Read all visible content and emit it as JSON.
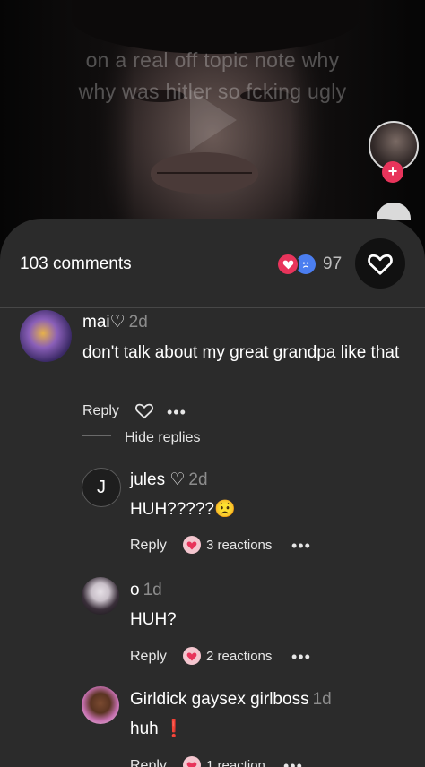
{
  "video": {
    "overlay_line1": "on a real off topic note why",
    "overlay_line2": "why was hitler so fcking ugly"
  },
  "sheet": {
    "comment_count": "103 comments",
    "reaction_count": "97"
  },
  "comments": [
    {
      "username": "mai♡",
      "time": "2d",
      "text": "don't talk about my great grandpa like that",
      "reply_label": "Reply",
      "hide_replies_label": "Hide replies"
    }
  ],
  "replies": [
    {
      "username": "jules ♡",
      "avatar_letter": "J",
      "time": "2d",
      "text": "HUH?????😟",
      "reply_label": "Reply",
      "reactions_label": "3 reactions"
    },
    {
      "username": "o",
      "time": "1d",
      "text": "HUH?",
      "reply_label": "Reply",
      "reactions_label": "2 reactions"
    },
    {
      "username": "Girldick gaysex girlboss",
      "time": "1d",
      "text": "huh ❗",
      "reply_label": "Reply",
      "reactions_label": "1 reaction"
    }
  ],
  "colors": {
    "sheet_bg": "#2b2b2b",
    "accent_red": "#e8345b",
    "accent_blue": "#4b7ef0",
    "muted_text": "#8c8c8c"
  },
  "icons": [
    "heart-outline-icon",
    "more-icon",
    "heart-reaction-icon",
    "sad-reaction-icon",
    "plus-icon"
  ]
}
